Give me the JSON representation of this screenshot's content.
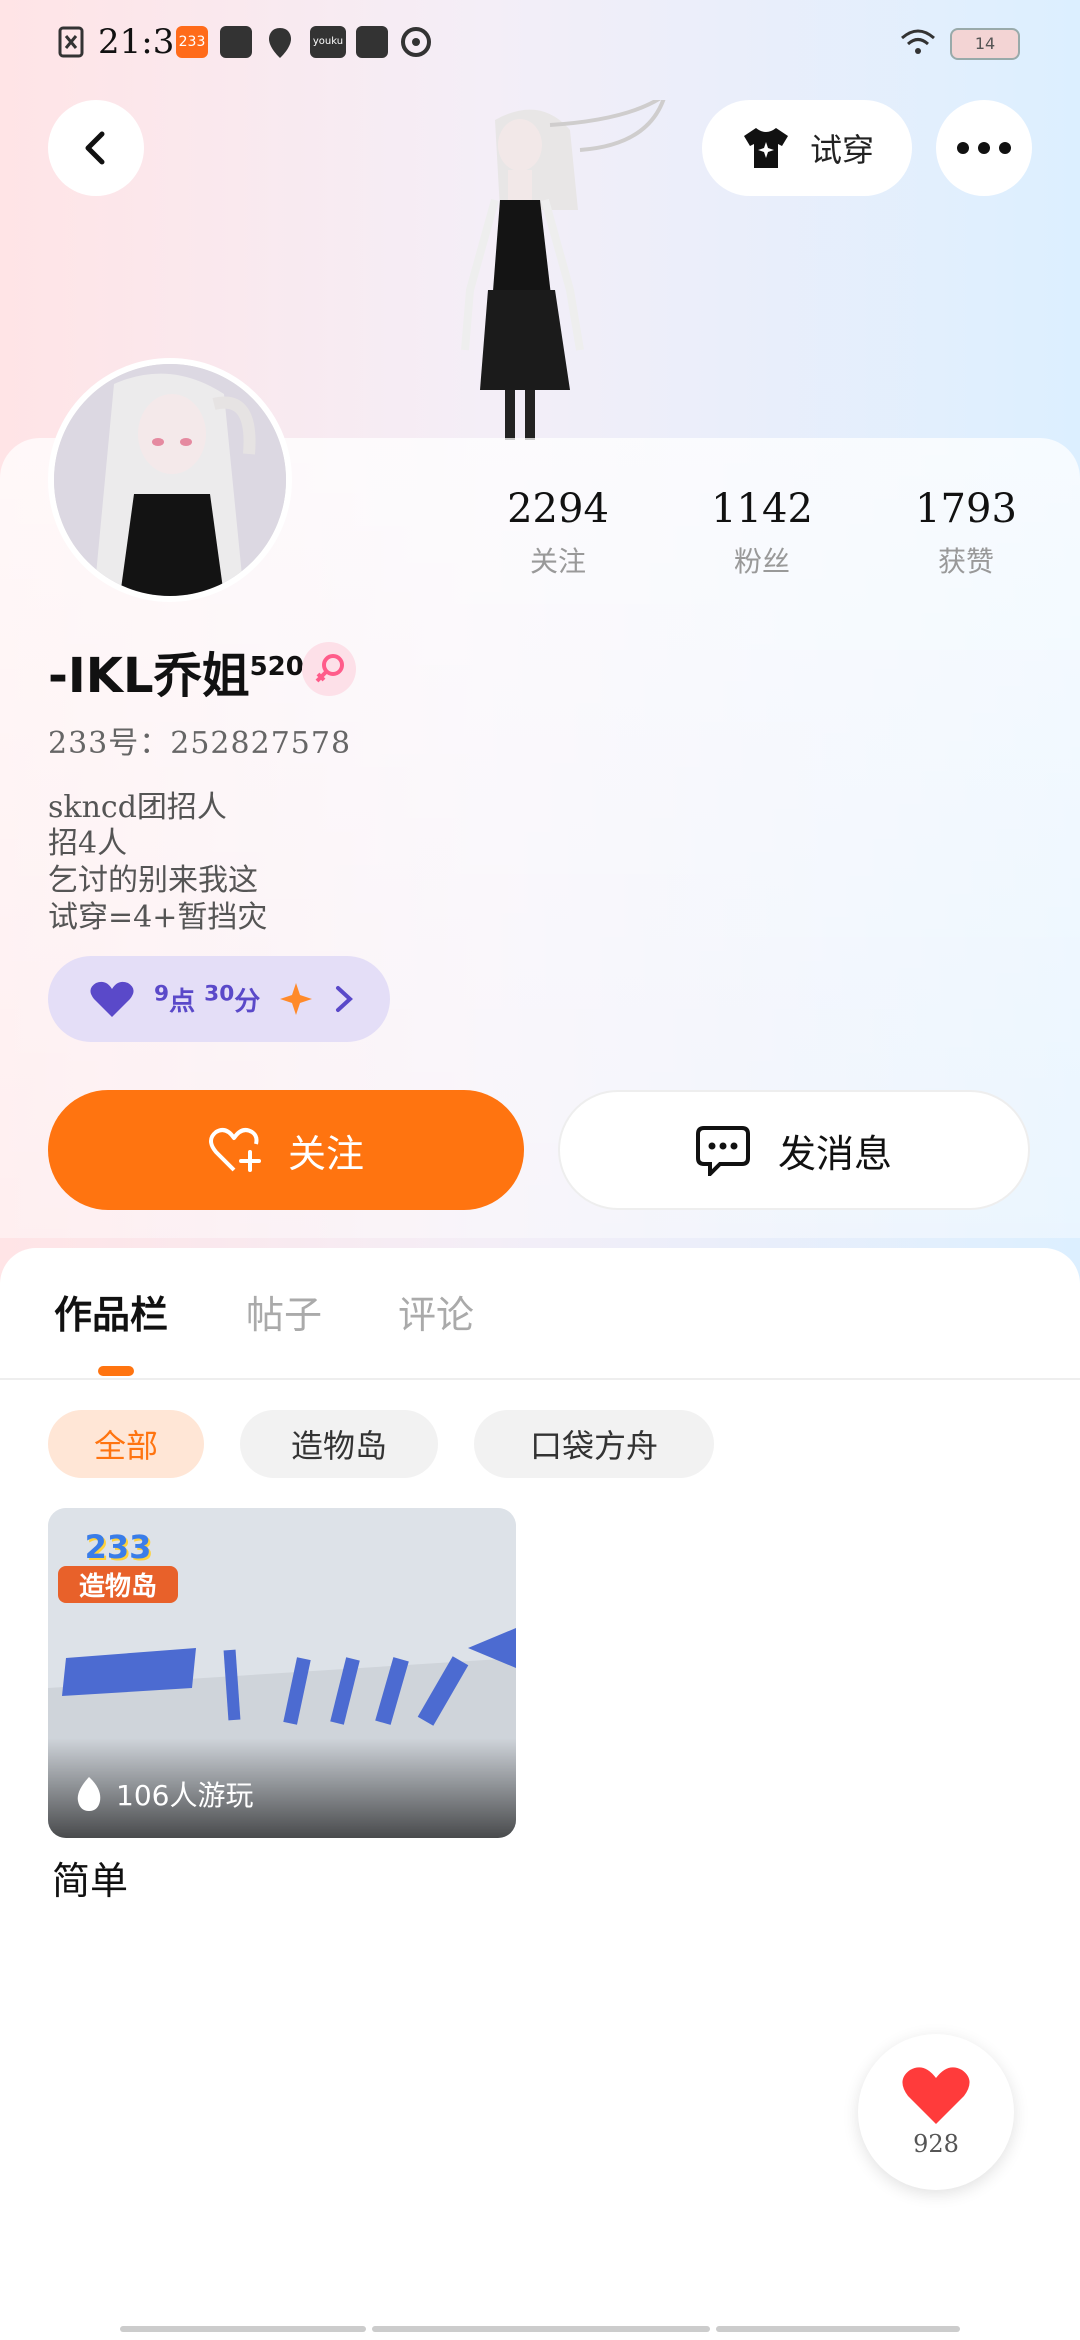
{
  "status_bar": {
    "time": "21:35",
    "battery": "14"
  },
  "header": {
    "try_on_label": "试穿"
  },
  "profile": {
    "name": "-IKL乔姐",
    "name_sup": "520",
    "uid": "233号：252827578",
    "bio": [
      "skncd团招人",
      "招4人",
      "乞讨的别来我这",
      "试穿=4+暂挡灾"
    ],
    "tag": {
      "hour": "9",
      "hour_unit": "点",
      "minute": "30",
      "minute_unit": "分"
    }
  },
  "stats": [
    {
      "value": "2294",
      "label": "关注"
    },
    {
      "value": "1142",
      "label": "粉丝"
    },
    {
      "value": "1793",
      "label": "获赞"
    }
  ],
  "actions": {
    "follow_label": "关注",
    "message_label": "发消息"
  },
  "tabs": [
    {
      "label": "作品栏",
      "active": true
    },
    {
      "label": "帖子",
      "active": false
    },
    {
      "label": "评论",
      "active": false
    }
  ],
  "filters": [
    {
      "label": "全部",
      "active": true
    },
    {
      "label": "造物岛",
      "active": false
    },
    {
      "label": "口袋方舟",
      "active": false
    }
  ],
  "works": [
    {
      "title": "简单",
      "players": "106人游玩",
      "badge_top": "233",
      "badge_bottom": "造物岛"
    }
  ],
  "like_fab": {
    "count": "928"
  },
  "colors": {
    "accent": "#ff7410",
    "tag_text": "#5a49c9"
  }
}
